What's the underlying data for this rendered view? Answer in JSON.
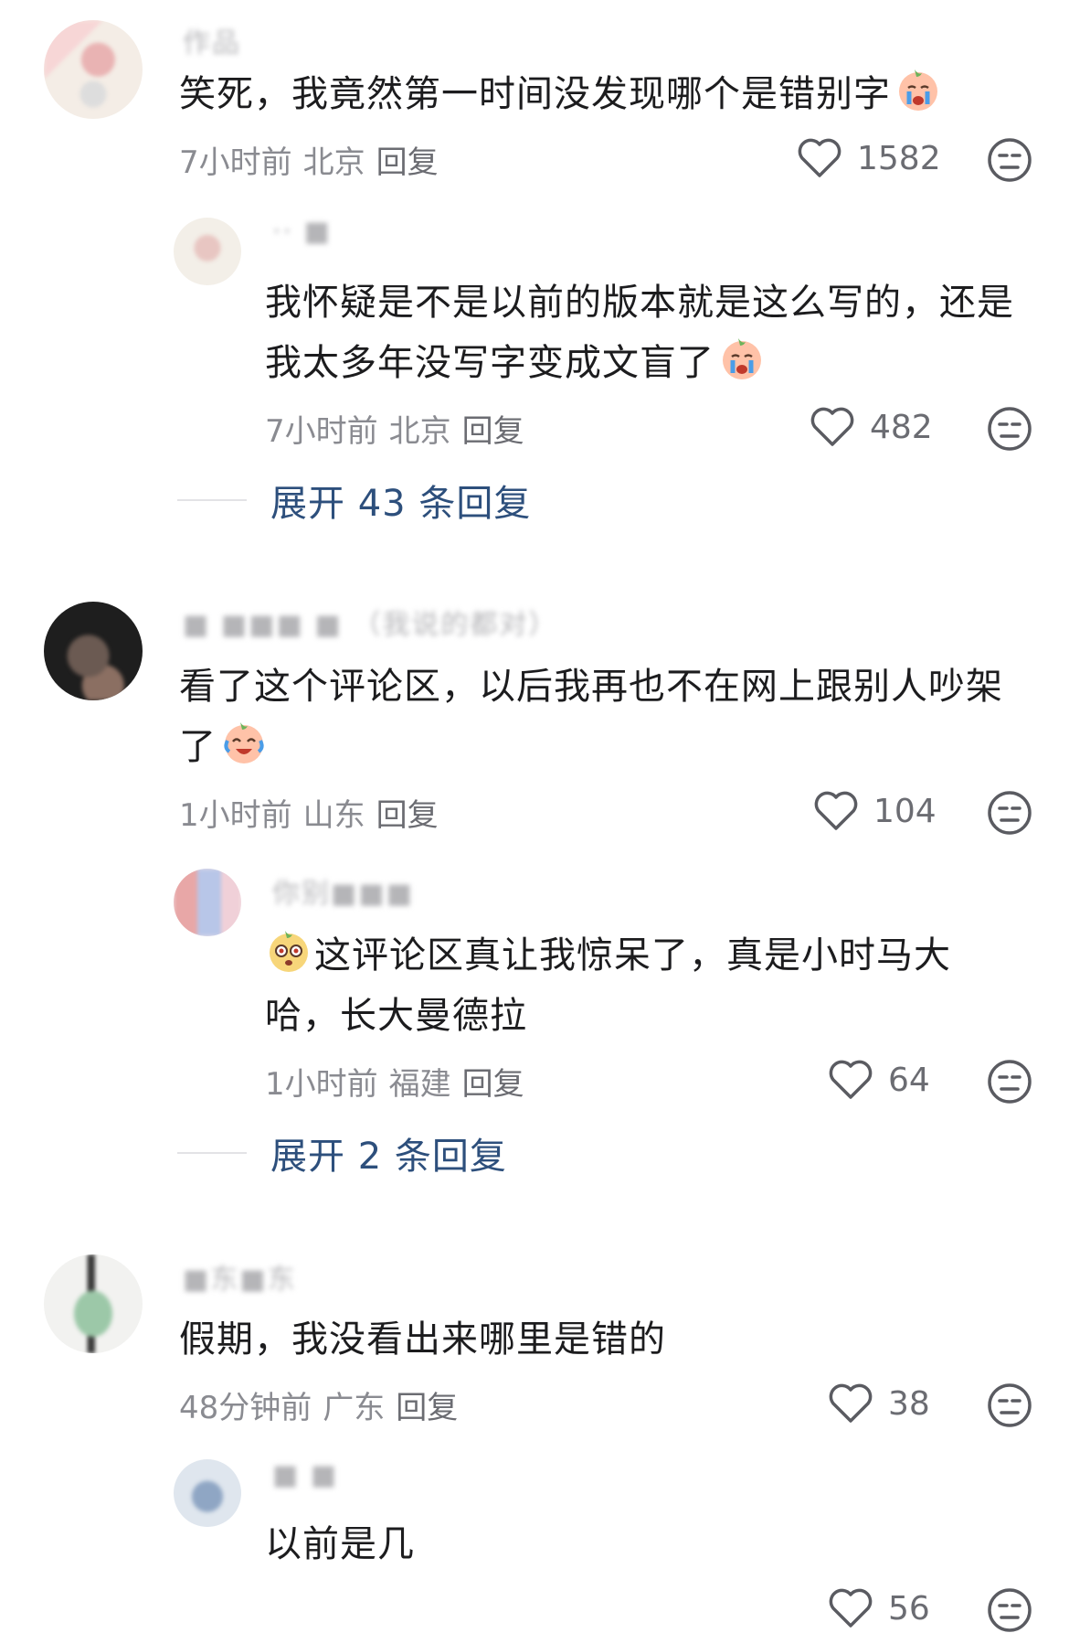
{
  "comments": [
    {
      "username": "作品",
      "text": "笑死，我竟然第一时间没发现哪个是错别字",
      "time": "7小时前",
      "location": "北京",
      "reply": "回复",
      "likes": "1582",
      "emoji": "crying-face-emoji",
      "replies": [
        {
          "username": "·· ■",
          "text": "我怀疑是不是以前的版本就是这么写的，还是我太多年没写字变成文盲了",
          "time": "7小时前",
          "location": "北京",
          "reply": "回复",
          "likes": "482",
          "emoji": "crying-face-emoji"
        }
      ],
      "expand": "展开 43 条回复"
    },
    {
      "username": "■ ■■■ ■ （我说的都对）",
      "text": "看了这个评论区，以后我再也不在网上跟别人吵架了",
      "time": "1小时前",
      "location": "山东",
      "reply": "回复",
      "likes": "104",
      "emoji": "laughing-tears-emoji",
      "replies": [
        {
          "username": "你别■■■",
          "text": "这评论区真让我惊呆了，真是小时马大哈，长大曼德拉",
          "time": "1小时前",
          "location": "福建",
          "reply": "回复",
          "likes": "64",
          "emoji": "shocked-face-emoji"
        }
      ],
      "expand": "展开 2 条回复"
    },
    {
      "username": "■东■东",
      "text": "假期，我没看出来哪里是错的",
      "time": "48分钟前",
      "location": "广东",
      "reply": "回复",
      "likes": "38",
      "replies": [
        {
          "username": "■ ■",
          "text": "以前是几",
          "time": "",
          "location": "",
          "reply": "",
          "likes": "56"
        }
      ]
    }
  ],
  "colors": {
    "link": "#2d4f7c",
    "meta": "#8a8b91",
    "text": "#1c1c1e"
  }
}
